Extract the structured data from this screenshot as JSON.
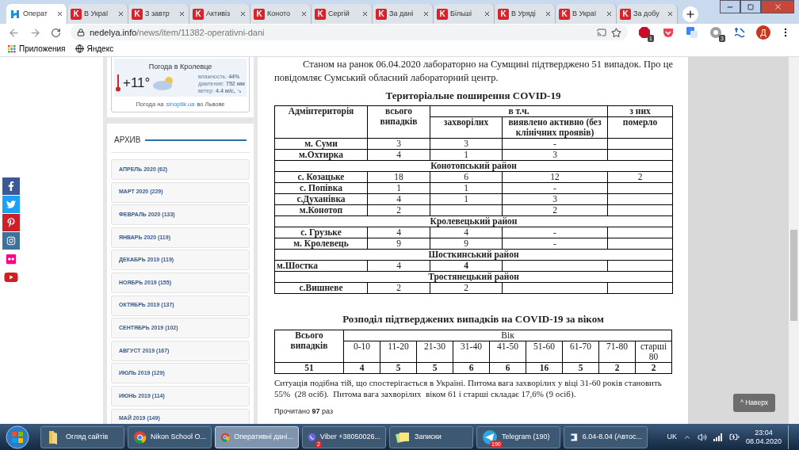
{
  "browser": {
    "tabs": [
      {
        "title": "Операт",
        "selected": true
      },
      {
        "title": "В Украї",
        "selected": false,
        "icon_text": "K"
      },
      {
        "title": "З завтр",
        "selected": false,
        "icon_text": "K"
      },
      {
        "title": "Активіз",
        "selected": false,
        "icon_text": "K"
      },
      {
        "title": "Коното",
        "selected": false,
        "icon_text": "K"
      },
      {
        "title": "Сергій",
        "selected": false,
        "icon_text": "K"
      },
      {
        "title": "За дані",
        "selected": false,
        "icon_text": "K"
      },
      {
        "title": "Більші",
        "selected": false,
        "icon_text": "K"
      },
      {
        "title": "В Уряді",
        "selected": false,
        "icon_text": "K"
      },
      {
        "title": "В Украї",
        "selected": false,
        "icon_text": "K"
      },
      {
        "title": "За добу",
        "selected": false,
        "icon_text": "K"
      }
    ],
    "url_host": "nedelya.info",
    "url_path": "/news/item/11382-operativni-dani",
    "extensions": [
      {
        "kind": "abp",
        "badge": "1"
      },
      {
        "kind": "pocket"
      },
      {
        "kind": "translate"
      },
      {
        "kind": "gear",
        "badge": "3"
      },
      {
        "kind": "wave"
      }
    ],
    "profile": "Д",
    "bookmarks": [
      {
        "kind": "apps",
        "label": "Приложения"
      },
      {
        "kind": "globe",
        "label": "Яндекс"
      }
    ]
  },
  "social": [
    {
      "kind": "facebook"
    },
    {
      "kind": "twitter"
    },
    {
      "kind": "pinterest"
    },
    {
      "kind": "instagram"
    },
    {
      "kind": "flickr"
    },
    {
      "kind": "youtube"
    }
  ],
  "sidebar": {
    "weather": {
      "title": "Погода в Кролевце",
      "temperature": "+11°",
      "lines": [
        "влажность: **44%**",
        "давление: **752 мм**",
        "ветер: **4.4 м/с,** ↘"
      ],
      "footer_before": "Погода на",
      "footer_link": "sinoptik.ua",
      "footer_after": "во Львове"
    },
    "archive": {
      "title": "АРХИВ",
      "items": [
        "АПРЕЛЬ 2020 (62)",
        "МАРТ 2020 (229)",
        "ФЕВРАЛЬ 2020 (133)",
        "ЯНВАРЬ 2020 (119)",
        "ДЕКАБРЬ 2019 (119)",
        "НОЯБРЬ 2019 (155)",
        "ОКТЯБРЬ 2019 (137)",
        "СЕНТЯБРЬ 2019 (102)",
        "АВГУСТ 2019 (167)",
        "ИЮЛЬ 2019 (129)",
        "ИЮНЬ 2019 (114)",
        "МАЙ 2019 (149)"
      ]
    }
  },
  "article": {
    "intro": "Станом на ранок 06.04.2020 лабораторно на Сумщині підтверджено 51 випадок. Про це повідомляє Сумський обласний лабораторний центр.",
    "table1": {
      "title": "Територіальне поширення COVID-19",
      "headers": {
        "place": "Адмінтериторія",
        "total": "всього випадків",
        "incl": "в т.ч.",
        "of_them": "з них",
        "ill": "захворілих",
        "active": "виявлено активно (без клінічних проявів)",
        "died": "померло"
      },
      "rows": [
        {
          "kind": "data",
          "place": "м. Суми",
          "total": "3",
          "ill": "3",
          "active": "-"
        },
        {
          "kind": "data",
          "place": "м.Охтирка",
          "total": "4",
          "ill": "1",
          "active": "3"
        },
        {
          "kind": "region",
          "name": "Конотопський район"
        },
        {
          "kind": "data",
          "place": "с. Козацьке",
          "total": "18",
          "ill": "6",
          "active": "12",
          "died": "2"
        },
        {
          "kind": "data",
          "place": "с. Попівка",
          "total": "1",
          "ill": "1",
          "active": "-"
        },
        {
          "kind": "data",
          "place": "с.Духанівка",
          "total": "4",
          "ill": "1",
          "active": "3"
        },
        {
          "kind": "data",
          "place": "м.Конотоп",
          "total": "2",
          "active": "2"
        },
        {
          "kind": "region",
          "name": "Кролевецький район"
        },
        {
          "kind": "data",
          "place": "с. Грузьке",
          "total": "4",
          "ill": "4",
          "active": "-"
        },
        {
          "kind": "data",
          "place": "м. Кролевець",
          "total": "9",
          "ill": "9",
          "active": "-"
        },
        {
          "kind": "region",
          "name": "Шосткинський район"
        },
        {
          "kind": "data",
          "place": "м.Шостка",
          "total": "4",
          "ill": "4",
          "place_left": true,
          "ill_bold": true
        },
        {
          "kind": "region",
          "name": "Тростянецький район"
        },
        {
          "kind": "data",
          "place": "с.Вишневе",
          "total": "2",
          "ill": "2"
        }
      ]
    },
    "table2": {
      "title": "Розподіл підтверджених випадків на COVID-19 за віком",
      "total_header": "Всього випадків",
      "age_header": "Вік",
      "groups": [
        "0-10",
        "11-20",
        "21-30",
        "31-40",
        "41-50",
        "51-60",
        "61-70",
        "71-80",
        "старші 80"
      ],
      "total": "51",
      "values": [
        "4",
        "5",
        "5",
        "6",
        "6",
        "16",
        "5",
        "2",
        "2"
      ]
    },
    "paragraph": "Ситуація подібна тій, що спостерігається в Україні. Питома вага захворілих у віці 31-60 років становить  55%  (28 осіб).  Питома вага захворілих  віком 61 і старші складає 17,6% (9 осіб).",
    "read_count": "Прочитано **97** раз"
  },
  "scroll_top": "^ Наверх",
  "taskbar": {
    "items": [
      {
        "kind": "folder",
        "label": "Огляд сайтів",
        "selected": false
      },
      {
        "kind": "chrome",
        "label": "Nikon School O...",
        "selected": false
      },
      {
        "kind": "chrome",
        "label": "Оперативні дані...",
        "selected": true
      },
      {
        "kind": "viber",
        "label": "Viber +38050026...",
        "selected": false,
        "badge": "2"
      },
      {
        "kind": "notes",
        "label": "Записки",
        "selected": false
      },
      {
        "kind": "telegram",
        "label": "Telegram (190)",
        "selected": false,
        "badge": "190"
      },
      {
        "kind": "word",
        "label": "6.04-8.04 (Автос...",
        "selected": false
      }
    ],
    "language": "UK",
    "time": "23:04",
    "date": "08.04.2020"
  }
}
